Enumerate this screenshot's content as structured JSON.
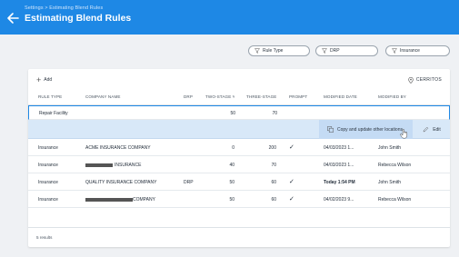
{
  "header": {
    "breadcrumb": "Settings > Estimating Blend Rules",
    "title": "Estimating Blend Rules"
  },
  "filters": [
    {
      "label": "Rule Type"
    },
    {
      "label": "DRP"
    },
    {
      "label": "Insurance"
    }
  ],
  "toolbar": {
    "add_label": "Add",
    "location_label": "CERRITOS"
  },
  "table": {
    "columns": [
      "RULE TYPE",
      "COMPANY NAME",
      "DRP",
      "TWO-STAGE %",
      "THREE-STAGE %",
      "PROMPT",
      "MODIFIED DATE",
      "MODIFIED BY"
    ],
    "rows": [
      {
        "rule_type": "Repair Facility",
        "company": "",
        "drp": "",
        "two_stage": "50",
        "three_stage": "70",
        "prompt": false,
        "modified_date": "",
        "modified_by": ""
      },
      {
        "rule_type": "Insurance",
        "company": "ACME INSURANCE COMPANY",
        "drp": "",
        "two_stage": "0",
        "three_stage": "200",
        "prompt": true,
        "modified_date": "04/03/2023 1...",
        "modified_by": "John Smith"
      },
      {
        "rule_type": "Insurance",
        "company": "INSURANCE",
        "drp": "",
        "two_stage": "40",
        "three_stage": "70",
        "prompt": false,
        "modified_date": "04/03/2023 1...",
        "modified_by": "Rebecca Wilson"
      },
      {
        "rule_type": "Insurance",
        "company": "QUALITY INSURANCE COMPANY",
        "drp": "DRP",
        "two_stage": "50",
        "three_stage": "60",
        "prompt": true,
        "modified_date": "Today 1:54 PM",
        "modified_by": "John Smith"
      },
      {
        "rule_type": "Insurance",
        "company": "COMPANY",
        "drp": "",
        "two_stage": "50",
        "three_stage": "60",
        "prompt": true,
        "modified_date": "04/02/2023 9...",
        "modified_by": "Rebecca Wilson"
      }
    ]
  },
  "row_actions": {
    "copy_label": "Copy and update other locations",
    "edit_label": "Edit"
  },
  "footer": {
    "results_label": "5 results"
  },
  "colors": {
    "header_bg": "#1e88e5",
    "accent": "#1e88e5",
    "check": "#43a047",
    "action_bar": "#d8e8f8"
  },
  "icons": [
    "back-arrow-icon",
    "filter-icon",
    "plus-icon",
    "location-pin-icon",
    "copy-icon",
    "pencil-icon",
    "check-icon",
    "hand-cursor-icon"
  ]
}
